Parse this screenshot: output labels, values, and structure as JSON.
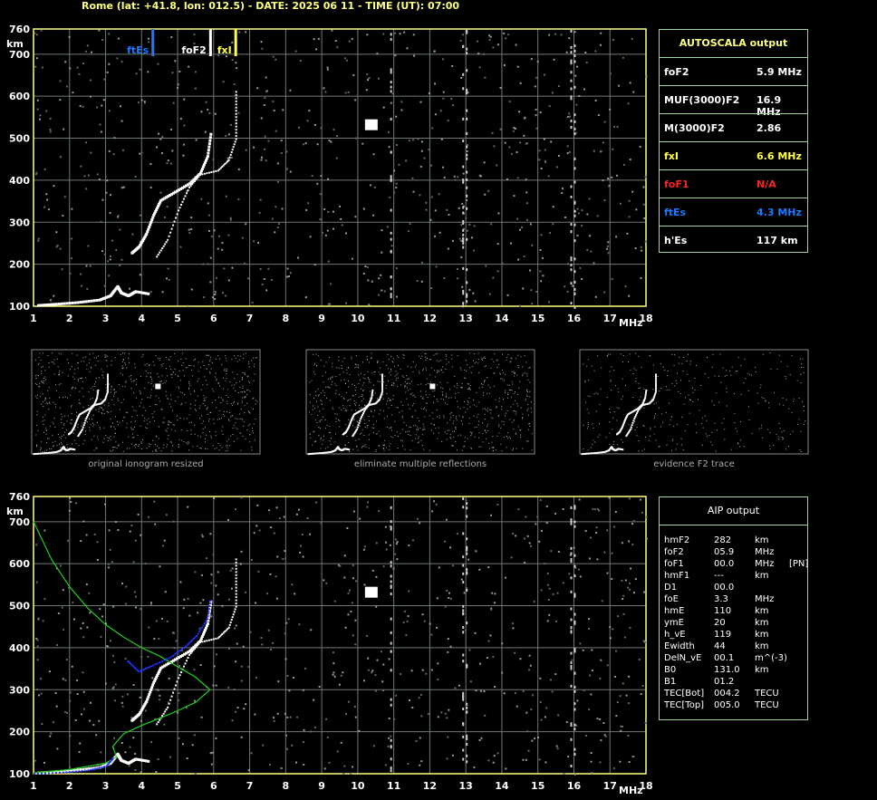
{
  "title": "Rome (lat: +41.8, lon: 012.5) - DATE: 2025 06 11 - TIME (UT): 07:00",
  "colors": {
    "frame": "#ffff80",
    "grid": "#6e7a6e",
    "boxBorder": "#9fd39f",
    "fxI": "#ffff40",
    "ftEs": "#1e78ff",
    "foF1": "#ff2020",
    "model": "#20d020",
    "trace": "#ffffff",
    "aipTrace": "#2030ff"
  },
  "chart_data": [
    {
      "type": "scatter",
      "name_id": "main-ionogram",
      "xlim": [
        1,
        18
      ],
      "ylim": [
        100,
        760
      ],
      "x_ticks": [
        1,
        2,
        3,
        4,
        5,
        6,
        7,
        8,
        9,
        10,
        11,
        12,
        13,
        14,
        15,
        16,
        17,
        18
      ],
      "y_ticks": [
        100,
        200,
        300,
        400,
        500,
        600,
        700,
        760
      ],
      "xunit": "MHz",
      "yunit": "km",
      "markers": [
        {
          "label": "ftEs",
          "x": 4.3,
          "color": "#1e78ff"
        },
        {
          "label": "foF2",
          "x": 5.9,
          "color": "#ffffff"
        },
        {
          "label": "fxI",
          "x": 6.6,
          "color": "#ffff40"
        }
      ],
      "o_trace": [
        [
          3.7,
          230
        ],
        [
          3.9,
          245
        ],
        [
          4.1,
          275
        ],
        [
          4.3,
          320
        ],
        [
          4.5,
          355
        ],
        [
          4.9,
          375
        ],
        [
          5.3,
          395
        ],
        [
          5.6,
          420
        ],
        [
          5.8,
          460
        ],
        [
          5.9,
          520
        ]
      ],
      "x_trace": [
        [
          4.4,
          220
        ],
        [
          4.7,
          260
        ],
        [
          5.0,
          330
        ],
        [
          5.3,
          385
        ],
        [
          5.6,
          415
        ],
        [
          6.1,
          425
        ],
        [
          6.4,
          450
        ],
        [
          6.6,
          500
        ],
        [
          6.6,
          560
        ],
        [
          6.6,
          620
        ]
      ],
      "e_trace": [
        [
          1.1,
          105
        ],
        [
          1.6,
          108
        ],
        [
          2.2,
          112
        ],
        [
          2.8,
          118
        ],
        [
          3.1,
          128
        ],
        [
          3.3,
          150
        ],
        [
          3.4,
          135
        ],
        [
          3.6,
          128
        ],
        [
          3.8,
          138
        ],
        [
          4.2,
          132
        ]
      ]
    },
    {
      "type": "scatter",
      "name_id": "aip-ionogram",
      "xlim": [
        1,
        18
      ],
      "ylim": [
        100,
        760
      ],
      "x_ticks": [
        1,
        2,
        3,
        4,
        5,
        6,
        7,
        8,
        9,
        10,
        11,
        12,
        13,
        14,
        15,
        16,
        17,
        18
      ],
      "y_ticks": [
        100,
        200,
        300,
        400,
        500,
        600,
        700,
        760
      ],
      "xunit": "MHz",
      "yunit": "km",
      "model_profile": [
        [
          1.0,
          700
        ],
        [
          1.5,
          610
        ],
        [
          2.0,
          545
        ],
        [
          2.5,
          495
        ],
        [
          3.0,
          455
        ],
        [
          3.5,
          425
        ],
        [
          4.0,
          400
        ],
        [
          4.5,
          380
        ],
        [
          5.0,
          355
        ],
        [
          5.5,
          330
        ],
        [
          5.9,
          300
        ],
        [
          5.5,
          270
        ],
        [
          5.0,
          250
        ],
        [
          4.5,
          232
        ],
        [
          4.0,
          215
        ],
        [
          3.5,
          195
        ],
        [
          3.2,
          165
        ],
        [
          3.3,
          140
        ],
        [
          3.0,
          125
        ],
        [
          2.0,
          110
        ],
        [
          1.0,
          102
        ]
      ],
      "aip_trace": [
        [
          3.6,
          370
        ],
        [
          3.9,
          345
        ],
        [
          4.3,
          360
        ],
        [
          4.8,
          380
        ],
        [
          5.2,
          405
        ],
        [
          5.5,
          430
        ],
        [
          5.8,
          470
        ],
        [
          5.9,
          520
        ]
      ],
      "aip_e": [
        [
          1.0,
          102
        ],
        [
          1.8,
          105
        ],
        [
          2.5,
          110
        ],
        [
          3.0,
          120
        ],
        [
          3.2,
          140
        ]
      ]
    }
  ],
  "autoscala": {
    "heading": "AUTOSCALA output",
    "rows": [
      {
        "k": "foF2",
        "v": "5.9 MHz",
        "color": "#ffffff"
      },
      {
        "k": "MUF(3000)F2",
        "v": "16.9 MHz",
        "color": "#ffffff"
      },
      {
        "k": "M(3000)F2",
        "v": "2.86",
        "color": "#ffffff"
      },
      {
        "k": "fxI",
        "v": "6.6 MHz",
        "color": "#ffff40"
      },
      {
        "k": "foF1",
        "v": "N/A",
        "color": "#ff2020"
      },
      {
        "k": "ftEs",
        "v": "4.3 MHz",
        "color": "#1e78ff"
      },
      {
        "k": "h'Es",
        "v": "117    km",
        "color": "#ffffff"
      }
    ]
  },
  "aip": {
    "heading": "AIP output",
    "rows": [
      {
        "k": "hmF2",
        "v": "282",
        "u": "km",
        "x": ""
      },
      {
        "k": "foF2",
        "v": "05.9",
        "u": "MHz",
        "x": ""
      },
      {
        "k": "foF1",
        "v": "00.0",
        "u": "MHz",
        "x": "[PN]"
      },
      {
        "k": "hmF1",
        "v": "---",
        "u": "km",
        "x": ""
      },
      {
        "k": "D1",
        "v": "00.0",
        "u": "",
        "x": ""
      },
      {
        "k": "foE",
        "v": "3.3",
        "u": "MHz",
        "x": ""
      },
      {
        "k": "hmE",
        "v": "110",
        "u": "km",
        "x": ""
      },
      {
        "k": "ymE",
        "v": "20",
        "u": "km",
        "x": ""
      },
      {
        "k": "h_vE",
        "v": "119",
        "u": "km",
        "x": ""
      },
      {
        "k": "Ewidth",
        "v": "44",
        "u": "km",
        "x": ""
      },
      {
        "k": "DelN_vE",
        "v": "00.1",
        "u": "m^(-3)",
        "x": ""
      },
      {
        "k": "B0",
        "v": "131.0",
        "u": "km",
        "x": ""
      },
      {
        "k": "B1",
        "v": "01.2",
        "u": "",
        "x": ""
      },
      {
        "k": "TEC[Bot]",
        "v": "004.2",
        "u": "TECU",
        "x": ""
      },
      {
        "k": "TEC[Top]",
        "v": "005.0",
        "u": "TECU",
        "x": ""
      }
    ]
  },
  "thumbnails": [
    {
      "caption": "original ionogram resized"
    },
    {
      "caption": "eliminate multiple reflections"
    },
    {
      "caption": "evidence F2 trace"
    }
  ]
}
